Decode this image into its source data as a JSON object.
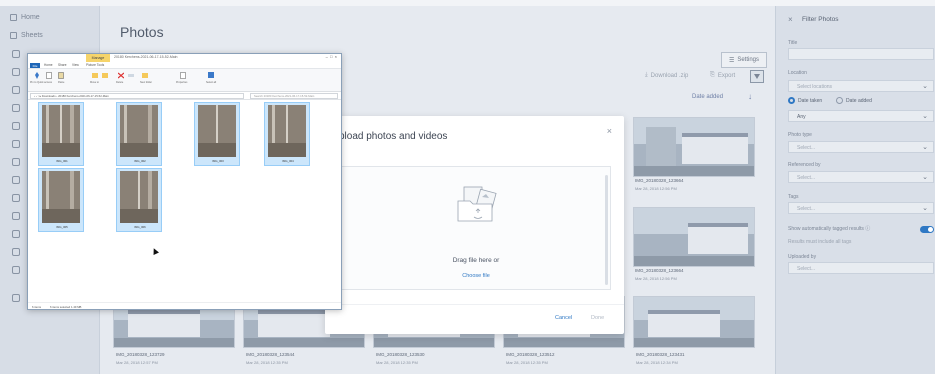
{
  "nav": {
    "home_label": "Home",
    "sheets_label": "Sheets"
  },
  "main": {
    "title": "Photos",
    "settings_label": "Settings",
    "download_label": "Download .zip",
    "export_label": "Export",
    "sort_label": "Date added",
    "photos": [
      {
        "name": "IMG_20180328_123664",
        "date": "Mar 28, 2018 12:56 PM"
      },
      {
        "name": "IMG_20180328_123664",
        "date": "Mar 28, 2018 12:56 PM"
      },
      {
        "name": "IMG_20180328_123729",
        "date": "Mar 28, 2018 12:57 PM"
      },
      {
        "name": "IMG_20180328_123544",
        "date": "Mar 28, 2018 12:35 PM"
      },
      {
        "name": "IMG_20180328_123530",
        "date": "Mar 28, 2018 12:35 PM"
      },
      {
        "name": "IMG_20180328_123512",
        "date": "Mar 28, 2018 12:35 PM"
      },
      {
        "name": "IMG_20180328_123431",
        "date": "Mar 28, 2018 12:34 PM"
      }
    ]
  },
  "dialog": {
    "title": "pload photos and videos",
    "close": "×",
    "drop_text": "Drag file here or",
    "choose_link": "Choose file",
    "cancel_label": "Cancel",
    "done_label": "Done"
  },
  "filter": {
    "close": "×",
    "title": "Filter Photos",
    "title_label": "Title",
    "location_label": "Location",
    "location_placeholder": "Select locations",
    "date_taken_label": "Date taken",
    "date_added_label": "Date added",
    "date_value": "Any",
    "photo_type_label": "Photo type",
    "photo_type_placeholder": "Select...",
    "referenced_by_label": "Referenced by",
    "referenced_by_placeholder": "Select...",
    "tags_label": "Tags",
    "tags_placeholder": "Select...",
    "auto_tag_label": "Show automatically tagged results ⓘ",
    "must_include_label": "Results must include all tags",
    "uploaded_by_label": "Uploaded by",
    "uploaded_by_placeholder": "Select..."
  },
  "explorer": {
    "manage_tab": "Manage",
    "title": "20180 Kerchens-2021-06-17-15-52-Main",
    "menu": [
      "File",
      "Home",
      "Share",
      "View",
      "Picture Tools"
    ],
    "address": "‹ › ↑  ▸ Downloads › 20180 Kerchens-2021-06-17-15-52-Main",
    "search_placeholder": "Search 20180 Kerchens-2021-06-17-15-52-Main",
    "ribbon_labels": [
      "Pin to Quick access",
      "Copy",
      "Paste",
      "Move to",
      "Copy to",
      "Delete",
      "Rename",
      "New folder",
      "Properties",
      "Select all"
    ],
    "files": [
      "IMG_001",
      "IMG_002",
      "IMG_003",
      "IMG_004",
      "IMG_005",
      "IMG_006"
    ],
    "status_count": "6 items",
    "status_selected": "6 items selected 1.49 MB"
  },
  "colors": {
    "accent": "#2f78c4",
    "overlay_bg": "#e6eaf0",
    "explorer_selection": "#cce6fb"
  }
}
